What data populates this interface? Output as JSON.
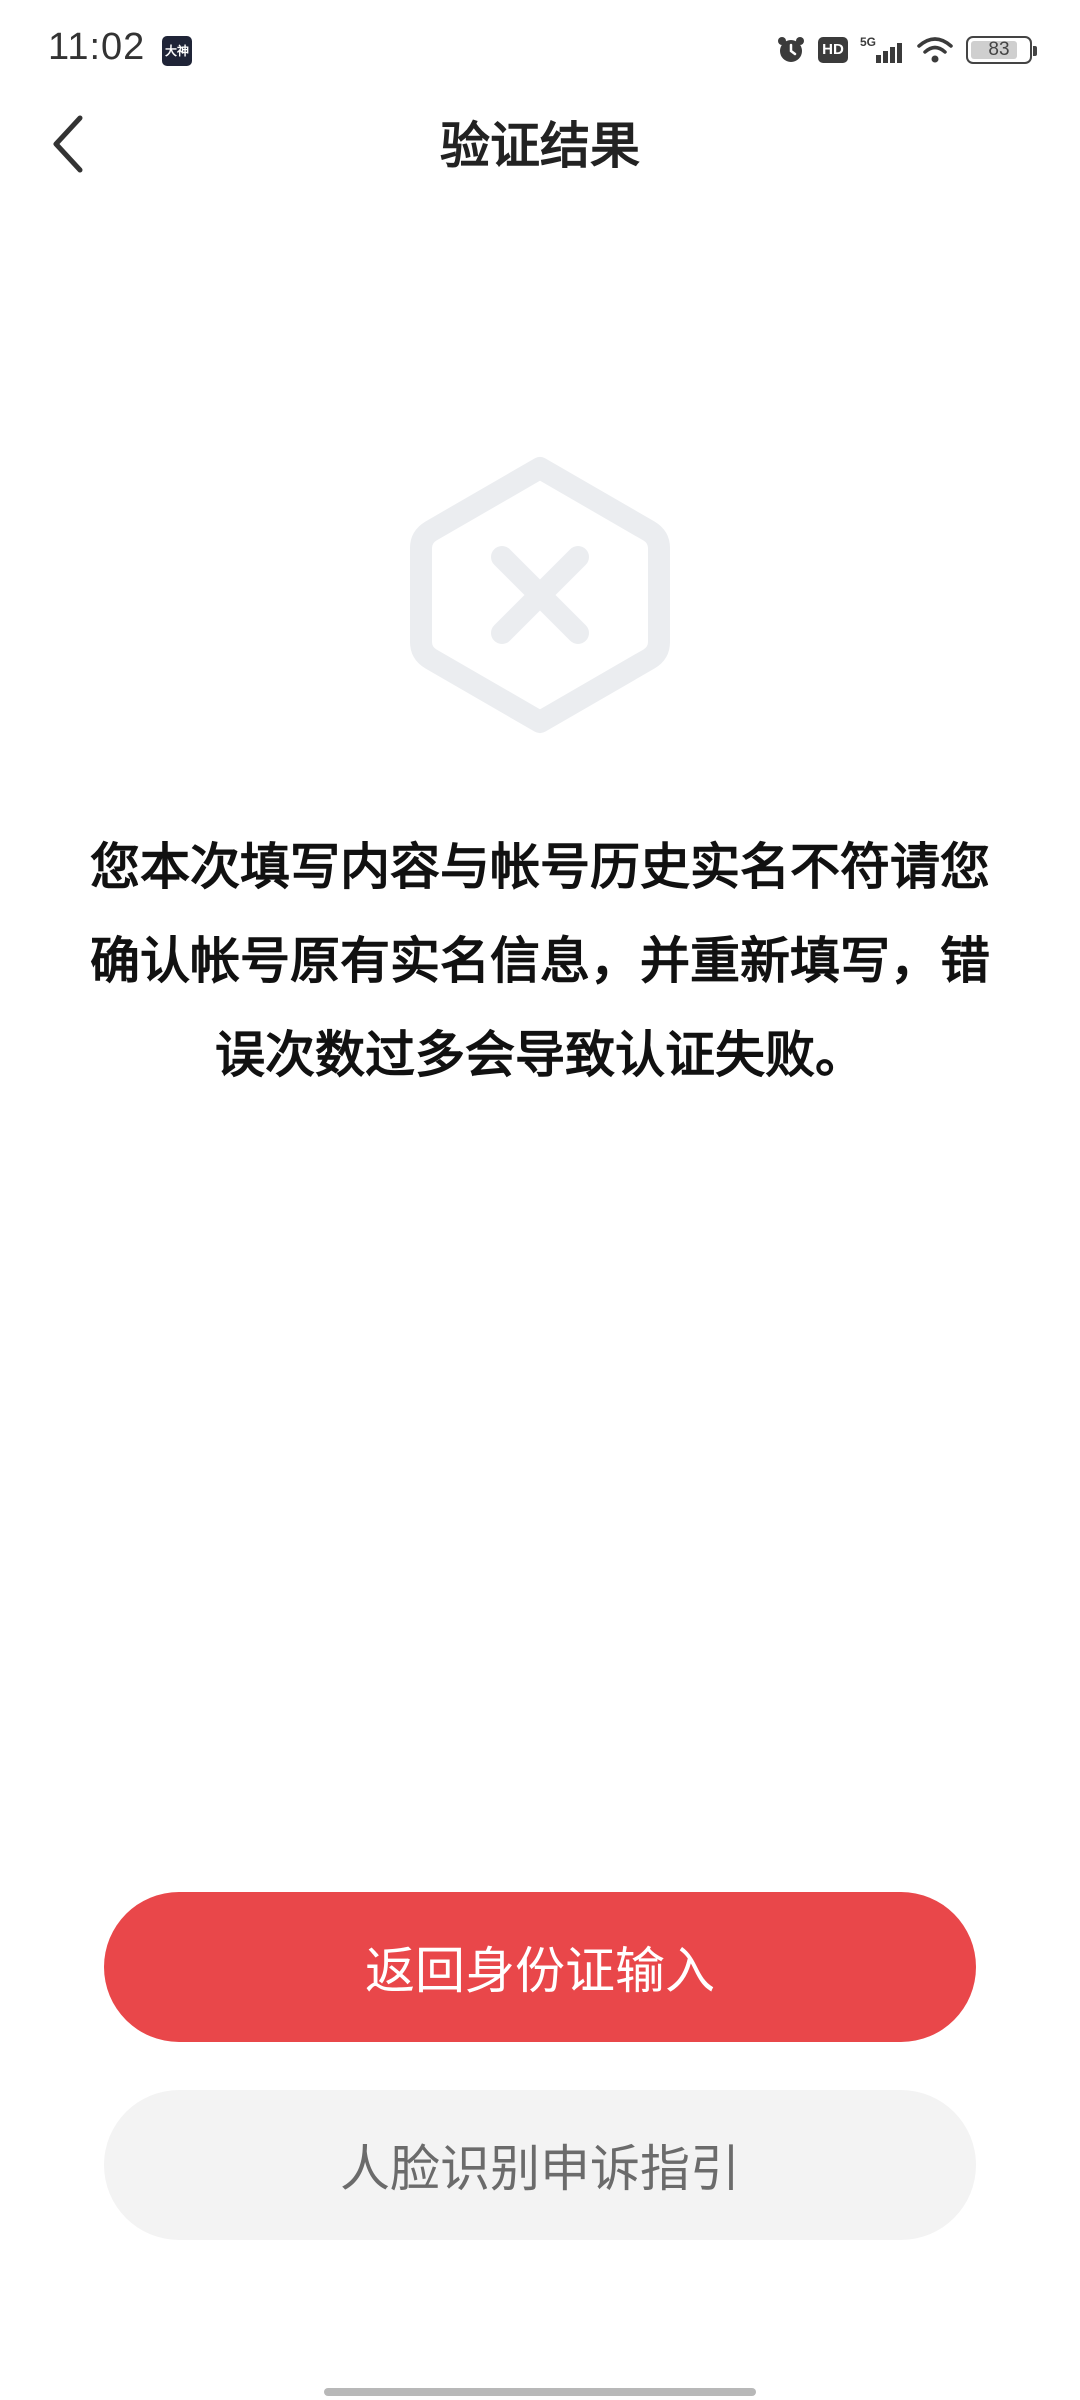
{
  "status_bar": {
    "time": "11:02",
    "app_badge": "大神",
    "hd_label": "HD",
    "network_label": "5G",
    "battery_level": "83",
    "battery_fraction": 0.83
  },
  "header": {
    "title": "验证结果"
  },
  "result": {
    "icon": "error-hexagon-icon",
    "message": "您本次填写内容与帐号历史实名不符请您确认帐号原有实名信息，并重新填写，错误次数过多会导致认证失败。"
  },
  "actions": {
    "primary_label": "返回身份证输入",
    "secondary_label": "人脸识别申诉指引"
  },
  "colors": {
    "primary_button": "#e9474a",
    "secondary_button": "#f3f3f3",
    "icon_gray": "#ebedf0"
  }
}
